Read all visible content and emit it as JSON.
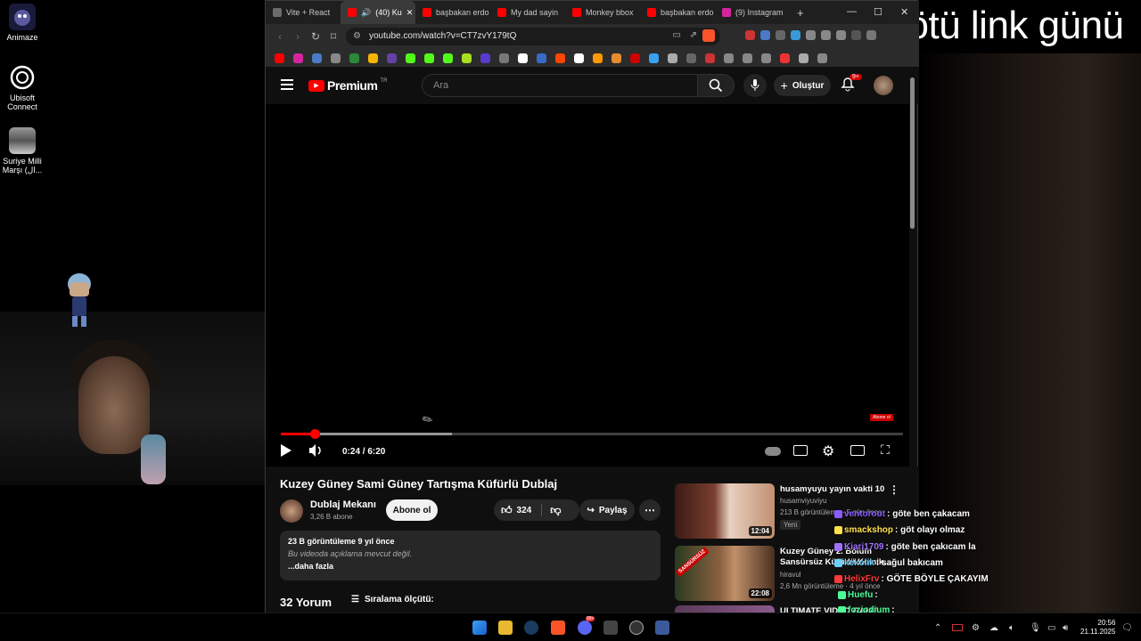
{
  "overlay": {
    "title": "kötü link günü"
  },
  "desktop": {
    "icons": [
      {
        "label": "Animaze"
      },
      {
        "label": "Ubisoft Connect"
      },
      {
        "label": "Suriye Milli Marşı (ال..."
      }
    ]
  },
  "browser": {
    "tabs": [
      {
        "label": "Vite + React",
        "color": "#6b6b6b"
      },
      {
        "label": "(40) Ku",
        "color": "#ff0000"
      },
      {
        "label": "başbakan erdo",
        "color": "#ff0000"
      },
      {
        "label": "My dad sayin",
        "color": "#ff0000"
      },
      {
        "label": "Monkey bbox",
        "color": "#ff0000"
      },
      {
        "label": "başbakan erdo",
        "color": "#ff0000"
      },
      {
        "label": "(9) Instagram",
        "color": "#d6249f"
      }
    ],
    "new_tab": "+",
    "url": "youtube.com/watch?v=CT7zvY179tQ"
  },
  "youtube": {
    "logo_text": "Premium",
    "logo_sup": "TR",
    "search_placeholder": "Ara",
    "create_label": "Oluştur",
    "notif_count": "9+",
    "player": {
      "time": "0:24 / 6:20",
      "progress_fraction": 0.055,
      "buffer_fraction": 0.275,
      "end_badge": "Abone ol"
    },
    "video": {
      "title": "Kuzey Güney Sami Güney Tartışma Küfürlü Dublaj",
      "channel": "Dublaj Mekanı",
      "subscribers": "3,26 B abone",
      "subscribe_label": "Abone ol",
      "likes": "324",
      "share_label": "Paylaş",
      "views_date": "23 B görüntüleme  9 yıl önce",
      "desc_text": "Bu videoda açıklama mevcut değil.",
      "more_label": "...daha fazla",
      "comments": "32 Yorum",
      "sort_label": "Sıralama ölçütü:"
    },
    "recommendations": [
      {
        "title": "husamyuyu yayın vakti 10",
        "channel": "husamviyuviyu",
        "meta": "213 B görüntüleme · 5 gün önce",
        "badge": "Yeni",
        "duration": "12:04"
      },
      {
        "title": "Kuzey Güney 2. Bölüm Sansürsüz Küfürlü Komik...",
        "channel": "hiravul",
        "meta": "2,6 Mn görüntüleme · 4 yıl önce",
        "duration": "22:08"
      },
      {
        "title": "ULTIMATE VIDEO GAME..."
      }
    ]
  },
  "chat": [
    {
      "user": "ventorout",
      "msg": ": göte ben çakacam",
      "color": "#8a5cff"
    },
    {
      "user": "smackshop",
      "msg": ": göt olayı olmaz",
      "color": "#ffe14d"
    },
    {
      "user": "Kiari1709",
      "msg": ": göte ben çakıcam la",
      "color": "#a070ff"
    },
    {
      "user": "kekolik",
      "msg": ": sağul bakıcam",
      "color": "#6ad0ff"
    },
    {
      "user": "HelixFrv",
      "msg": ": GÖTE BÖYLE ÇAKAYIM",
      "color": "#ff3a3a"
    },
    {
      "user": "Huefu",
      "msg": ":",
      "color": "#4aff9a"
    },
    {
      "user": "foziodium",
      "msg": ":",
      "color": "#4aff9a"
    }
  ],
  "taskbar": {
    "time": "20:56",
    "date": "21.11.2025",
    "discord_badge": "99+"
  }
}
